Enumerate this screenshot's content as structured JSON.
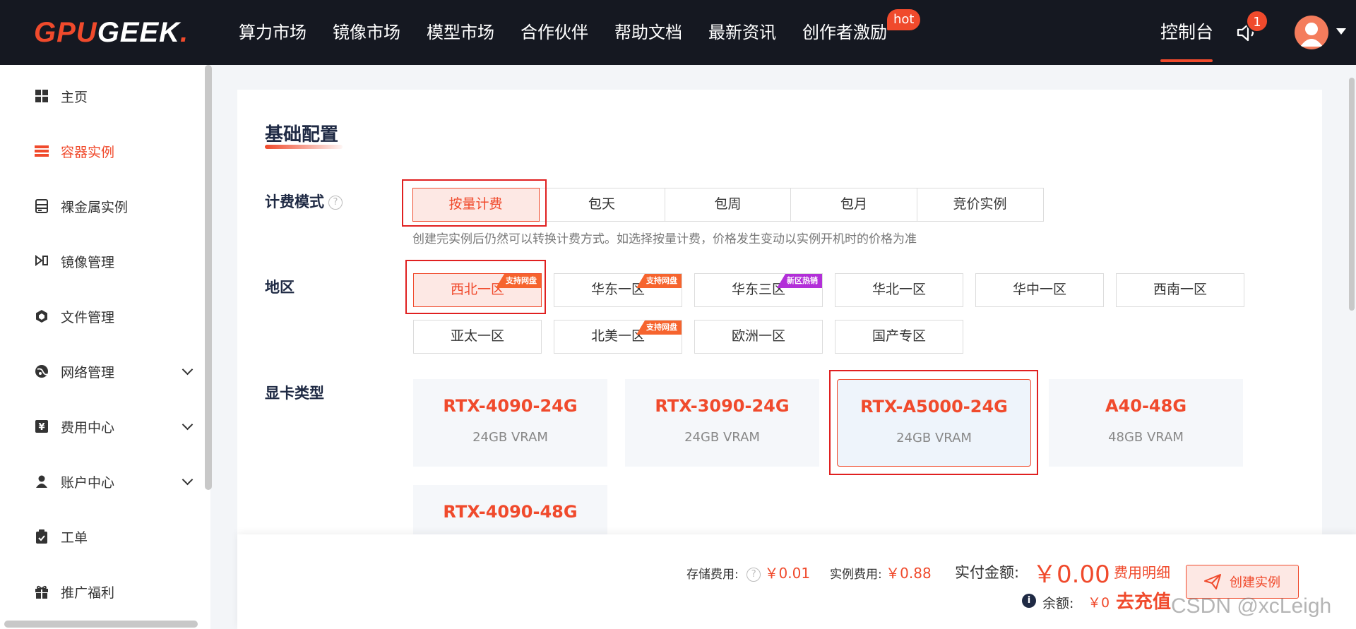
{
  "brand": {
    "part1": "GPU",
    "part2": "GEEK",
    "dot": "."
  },
  "nav": {
    "items": [
      "算力市场",
      "镜像市场",
      "模型市场",
      "合作伙伴",
      "帮助文档",
      "最新资讯",
      "创作者激励"
    ],
    "hot_badge": "hot",
    "console": "控制台",
    "notification_count": "1"
  },
  "sidebar": {
    "items": [
      {
        "label": "主页",
        "icon": "grid-icon"
      },
      {
        "label": "容器实例",
        "icon": "server-icon"
      },
      {
        "label": "裸金属实例",
        "icon": "bare-metal-icon"
      },
      {
        "label": "镜像管理",
        "icon": "image-icon"
      },
      {
        "label": "文件管理",
        "icon": "file-icon"
      },
      {
        "label": "网络管理",
        "icon": "network-icon"
      },
      {
        "label": "费用中心",
        "icon": "yen-icon"
      },
      {
        "label": "账户中心",
        "icon": "user-icon"
      },
      {
        "label": "工单",
        "icon": "clipboard-icon"
      },
      {
        "label": "推广福利",
        "icon": "gift-icon"
      }
    ],
    "active_index": 1
  },
  "config": {
    "title": "基础配置",
    "billing": {
      "label": "计费模式",
      "help": "?",
      "options": [
        "按量计费",
        "包天",
        "包周",
        "包月",
        "竞价实例"
      ],
      "selected": "按量计费",
      "note": "创建完实例后仍然可以转换计费方式。如选择按量计费，价格发生变动以实例开机时的价格为准"
    },
    "region": {
      "label": "地区",
      "options": [
        {
          "name": "西北一区",
          "tag": "支持网盘"
        },
        {
          "name": "华东一区",
          "tag": "支持网盘"
        },
        {
          "name": "华东三区",
          "tag": "新区热销"
        },
        {
          "name": "华北一区",
          "tag": ""
        },
        {
          "name": "华中一区",
          "tag": ""
        },
        {
          "name": "西南一区",
          "tag": ""
        },
        {
          "name": "亚太一区",
          "tag": ""
        },
        {
          "name": "北美一区",
          "tag": "支持网盘"
        },
        {
          "name": "欧洲一区",
          "tag": ""
        },
        {
          "name": "国产专区",
          "tag": ""
        }
      ],
      "selected": "西北一区"
    },
    "gpu": {
      "label": "显卡类型",
      "options": [
        {
          "name": "RTX-4090-24G",
          "vram": "24GB VRAM"
        },
        {
          "name": "RTX-3090-24G",
          "vram": "24GB VRAM"
        },
        {
          "name": "RTX-A5000-24G",
          "vram": "24GB VRAM"
        },
        {
          "name": "A40-48G",
          "vram": "48GB VRAM"
        },
        {
          "name": "RTX-4090-48G",
          "vram": ""
        }
      ],
      "selected": "RTX-A5000-24G"
    }
  },
  "footer": {
    "storage_label": "存储费用:",
    "storage_value": "￥0.01",
    "instance_label": "实例费用:",
    "instance_value": "￥0.88",
    "total_label": "实付金额:",
    "total_value": "￥0.00",
    "fee_detail": "费用明细",
    "balance_label": "余额:",
    "balance_value": "￥0",
    "recharge": "去充值",
    "create_button": "创建实例",
    "watermark": "CSDN @xcLeigh"
  },
  "colors": {
    "accent": "#f04a2c",
    "nav_bg": "#151821",
    "tag_orange": "#f6642e",
    "tag_purple": "#b22fd8"
  }
}
